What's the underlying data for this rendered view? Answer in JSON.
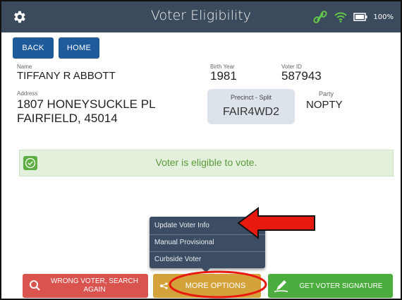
{
  "header": {
    "title": "Voter Eligibility",
    "battery": "100%"
  },
  "nav": {
    "back": "BACK",
    "home": "HOME"
  },
  "voter": {
    "name_label": "Name",
    "name": "TIFFANY R ABBOTT",
    "birth_year_label": "Birth Year",
    "birth_year": "1981",
    "voter_id_label": "Voter ID",
    "voter_id": "587943",
    "address_label": "Address",
    "address_line1": "1807 HONEYSUCKLE PL",
    "address_line2": "FAIRFIELD, 45014",
    "precinct_label": "Precinct - Split",
    "precinct": "FAIR4WD2",
    "party_label": "Party",
    "party": "NOPTY"
  },
  "eligibility": {
    "message": "Voter is eligible to vote."
  },
  "more_menu": {
    "items": [
      "Update Voter Info",
      "Manual Provisional",
      "Curbside Voter"
    ]
  },
  "actions": {
    "wrong_voter": "WRONG VOTER, SEARCH AGAIN",
    "more_options": "MORE OPTIONS",
    "get_signature": "GET VOTER SIGNATURE"
  },
  "colors": {
    "topbar": "#3b4a5c",
    "nav_button": "#1f5a9a",
    "eligible_bg": "#e3f0dc",
    "wrong_voter": "#d9534f",
    "more_options": "#d4a23a",
    "get_signature": "#4cad3f",
    "annotation": "#e8190f"
  },
  "icons": {
    "settings": "gear-icon",
    "link": "link-icon",
    "wifi": "wifi-icon",
    "battery": "battery-icon",
    "check": "check-icon",
    "search": "search-icon",
    "options": "options-icon",
    "pen": "pen-icon"
  }
}
